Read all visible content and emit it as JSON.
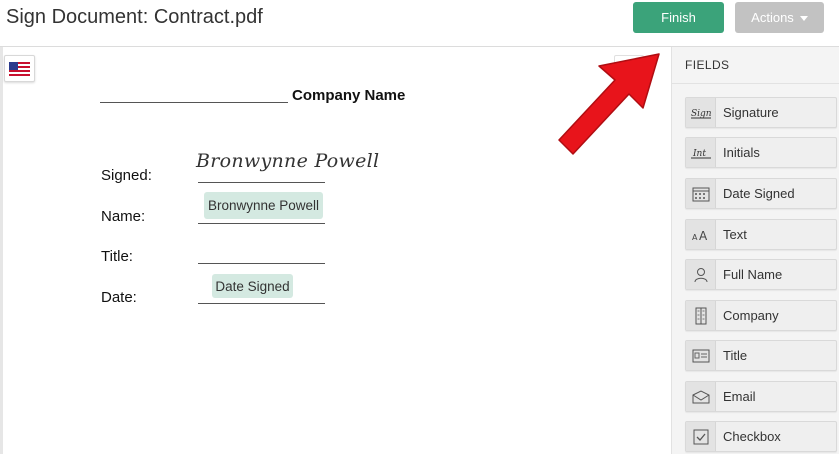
{
  "header": {
    "title": "Sign Document: Contract.pdf",
    "finish_label": "Finish",
    "actions_label": "Actions"
  },
  "document": {
    "company_name": "Company Name",
    "labels": {
      "signed": "Signed:",
      "name": "Name:",
      "title": "Title:",
      "date": "Date:"
    },
    "signature_text": "Bronwynne Powell",
    "name_field_value": "Bronwynne Powell",
    "date_field_value": "Date Signed"
  },
  "sidebar": {
    "title": "FIELDS",
    "fields": [
      {
        "label": "Signature",
        "icon": "signature-icon"
      },
      {
        "label": "Initials",
        "icon": "initials-icon"
      },
      {
        "label": "Date Signed",
        "icon": "calendar-icon"
      },
      {
        "label": "Text",
        "icon": "text-icon"
      },
      {
        "label": "Full Name",
        "icon": "person-icon"
      },
      {
        "label": "Company",
        "icon": "building-icon"
      },
      {
        "label": "Title",
        "icon": "id-card-icon"
      },
      {
        "label": "Email",
        "icon": "envelope-icon"
      },
      {
        "label": "Checkbox",
        "icon": "checkbox-icon"
      }
    ]
  },
  "colors": {
    "finish": "#3ba37a",
    "actions": "#c2c2c2",
    "chip": "#d4e9e1",
    "arrow": "#e8141b"
  }
}
